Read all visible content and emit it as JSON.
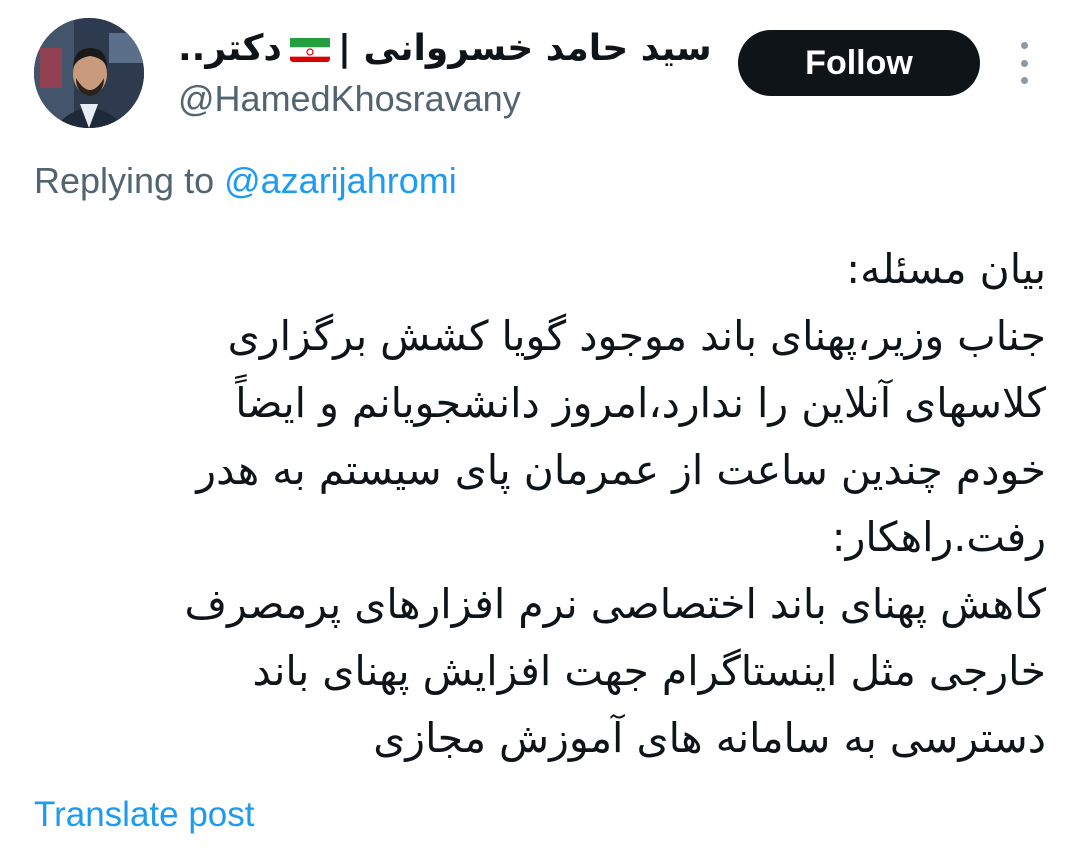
{
  "author": {
    "name_part1": "سید حامد خسروانی |",
    "flag_icon": "iran-flag-icon",
    "name_part2": "دکتر..",
    "handle": "@HamedKhosravany"
  },
  "actions": {
    "follow_label": "Follow",
    "more_icon": "more-vertical-icon"
  },
  "reply": {
    "prefix": "Replying to ",
    "mention": "@azarijahromi"
  },
  "body": {
    "lines": [
      "بیان مسئله:",
      "جناب وزیر،پهنای باند موجود گویا کشش برگزاری",
      "کلاسهای آنلاین را ندارد،امروز دانشجویانم و ایضاً",
      "خودم چندین ساعت از عمرمان پای سیستم به هدر",
      "رفت.راهکار:",
      "کاهش پهنای باند اختصاصی نرم افزارهای پرمصرف",
      "خارجی مثل اینستاگرام جهت افزایش پهنای باند",
      "دسترسی به سامانه های آموزش مجازی"
    ]
  },
  "translate_label": "Translate post",
  "colors": {
    "text": "#0f1419",
    "secondary": "#536471",
    "link": "#1d9bf0",
    "follow_bg": "#0f1419"
  }
}
